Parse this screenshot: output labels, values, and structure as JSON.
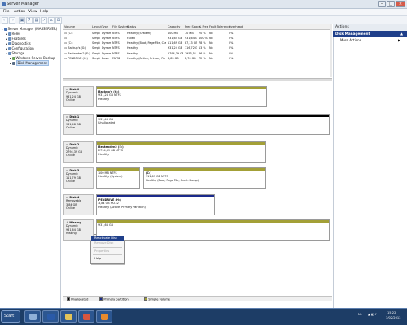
{
  "window": {
    "title": "Server Manager",
    "min": "–",
    "max": "□",
    "close": "×"
  },
  "menu": [
    "File",
    "Action",
    "View",
    "Help"
  ],
  "toolbar": [
    "←",
    "→",
    "▣",
    "?",
    "▤",
    "✓",
    "⌂",
    "⊞"
  ],
  "tree": {
    "items": [
      {
        "label": "Server Manager (MASSERVER)",
        "color": "#4a74b5",
        "indent": 0
      },
      {
        "label": "Roles",
        "color": "#6a8fbe",
        "indent": 1
      },
      {
        "label": "Features",
        "color": "#6a8fbe",
        "indent": 1
      },
      {
        "label": "Diagnostics",
        "color": "#6a8fbe",
        "indent": 1
      },
      {
        "label": "Configuration",
        "color": "#6a8fbe",
        "indent": 1
      },
      {
        "label": "Storage",
        "color": "#6a8fbe",
        "indent": 1
      },
      {
        "label": "Windows Server Backup",
        "color": "#6aa05a",
        "indent": 2
      },
      {
        "label": "Disk Management",
        "color": "#5b6e87",
        "indent": 2,
        "selected": true
      }
    ]
  },
  "volume_list": {
    "columns": [
      "Volume",
      "Layout",
      "Type",
      "File System",
      "Status",
      "Capacity",
      "Free Space",
      "% Free",
      "Fault Tolerance",
      "Overhead"
    ],
    "rows": [
      [
        "(C:)",
        "Simple",
        "Dynamic",
        "NTFS",
        "Healthy (System)",
        "100 MB",
        "70 MB",
        "70 %",
        "No",
        "0%"
      ],
      [
        "",
        "Simple",
        "Dynamic",
        "NTFS",
        "Failed",
        "931,64 GB",
        "931,64 GB",
        "100 %",
        "No",
        "0%"
      ],
      [
        "(C:)",
        "Simple",
        "Dynamic",
        "NTFS",
        "Healthy (Boot, Page File, Crash Dump)",
        "111,69 GB",
        "87,13 GB",
        "78 %",
        "No",
        "0%"
      ],
      [
        "Backup's (G:)",
        "Simple",
        "Dynamic",
        "NTFS",
        "Healthy",
        "931,24 GB",
        "116,72 GB",
        "13 %",
        "No",
        "0%"
      ],
      [
        "Bestanden2 (E:)",
        "Simple",
        "Dynamic",
        "NTFS",
        "Healthy",
        "2794,39 GB",
        "1953,51 GB",
        "66 %",
        "No",
        "0%"
      ],
      [
        "PENDRIVE (H:)",
        "Simple",
        "Basic",
        "FAT32",
        "Healthy (Active, Primary Partition)",
        "3,83 GB",
        "2,76 GB",
        "72 %",
        "No",
        "0%"
      ]
    ]
  },
  "disks": [
    {
      "name": "Disk 0",
      "type": "Dynamic",
      "size": "931,24 GB",
      "status": "Online",
      "parts": [
        {
          "kind": "simple",
          "lines": [
            "Backup's (G:)",
            "931,24 GB NTFS",
            "Healthy"
          ]
        }
      ]
    },
    {
      "name": "Disk 1",
      "type": "Dynamic",
      "size": "931,48 GB",
      "status": "Online",
      "parts": [
        {
          "kind": "unalloc",
          "lines": [
            "",
            "931,48 GB",
            "Unallocated"
          ]
        }
      ]
    },
    {
      "name": "Disk 2",
      "type": "Dynamic",
      "size": "2794,39 GB",
      "status": "Online",
      "parts": [
        {
          "kind": "simple",
          "lines": [
            "Bestanden2 (E:)",
            "2794,39 GB NTFS",
            "Healthy"
          ]
        }
      ]
    },
    {
      "name": "Disk 3",
      "type": "Dynamic",
      "size": "111,79 GB",
      "status": "Online",
      "parts": [
        {
          "kind": "simple",
          "lines": [
            "",
            "100 MB NTFS",
            "Healthy (System)"
          ]
        },
        {
          "kind": "simple",
          "lines": [
            "(C:)",
            "111,69 GB NTFS",
            "Healthy (Boot, Page File, Crash Dump)"
          ]
        }
      ]
    },
    {
      "name": "Disk 4",
      "type": "Removable",
      "size": "3,84 GB",
      "status": "Online",
      "parts": [
        {
          "kind": "primary",
          "lines": [
            "PENDRIVE (H:)",
            "3,84 GB FAT32",
            "Healthy (Active, Primary Partition)"
          ]
        }
      ]
    },
    {
      "name": "Missing",
      "type": "Dynamic",
      "size": "931,64 GB",
      "status": "Missing",
      "parts": [
        {
          "kind": "simple",
          "lines": [
            "",
            "931,64 GB",
            ""
          ]
        }
      ]
    }
  ],
  "context_menu": {
    "items": [
      {
        "label": "Reactivate Disk",
        "state": "highlighted"
      },
      {
        "label": "Remove Disk",
        "state": "disabled"
      },
      {
        "label": "",
        "state": "separator"
      },
      {
        "label": "Properties",
        "state": "disabled"
      },
      {
        "label": "",
        "state": "separator"
      },
      {
        "label": "Help",
        "state": "normal"
      }
    ]
  },
  "legend": [
    {
      "label": "Unallocated",
      "color": "#000000"
    },
    {
      "label": "Primary partition",
      "color": "#1b2a8b"
    },
    {
      "label": "Simple volume",
      "color": "#a3a037"
    }
  ],
  "actions": {
    "header": "Actions",
    "section": "Disk Management",
    "item": "More Actions"
  },
  "taskbar": {
    "start": "Start",
    "apps": [
      {
        "name": "server-manager",
        "color": "#8fb0d8"
      },
      {
        "name": "powershell",
        "color": "#2a5aa8"
      },
      {
        "name": "explorer",
        "color": "#e2c35a"
      },
      {
        "name": "chrome",
        "color": "#d8553f"
      },
      {
        "name": "firefox",
        "color": "#e98a2c"
      }
    ],
    "lang": "NL",
    "time": "15:22",
    "date": "3/02/2013"
  }
}
